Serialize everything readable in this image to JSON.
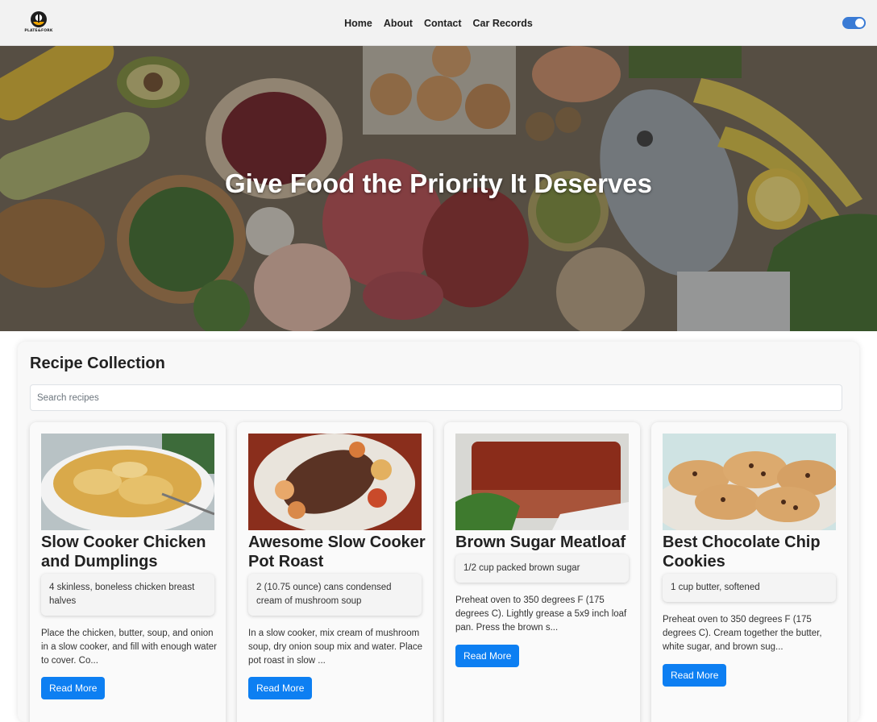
{
  "header": {
    "logo_text": "PLATE&FORK",
    "nav": [
      "Home",
      "About",
      "Contact",
      "Car Records"
    ]
  },
  "hero": {
    "title": "Give Food the Priority It Deserves"
  },
  "collection": {
    "title": "Recipe Collection",
    "search_placeholder": "Search recipes",
    "recipes": [
      {
        "title": "Slow Cooker Chicken and Dumplings",
        "ingredient": "4 skinless, boneless chicken breast halves",
        "description": "Place the chicken, butter, soup, and onion in a slow cooker, and fill with enough water to cover. Co...",
        "button": "Read More"
      },
      {
        "title": "Awesome Slow Cooker Pot Roast",
        "ingredient": "2 (10.75 ounce) cans condensed cream of mushroom soup",
        "description": "In a slow cooker, mix cream of mushroom soup, dry onion soup mix and water. Place pot roast in slow ...",
        "button": "Read More"
      },
      {
        "title": "Brown Sugar Meatloaf",
        "ingredient": "1/2 cup packed brown sugar",
        "description": "Preheat oven to 350 degrees F (175 degrees C). Lightly grease a 5x9 inch loaf pan. Press the brown s...",
        "button": "Read More"
      },
      {
        "title": "Best Chocolate Chip Cookies",
        "ingredient": "1 cup butter, softened",
        "description": "Preheat oven to 350 degrees F (175 degrees C). Cream together the butter, white sugar, and brown sug...",
        "button": "Read More"
      }
    ]
  },
  "colors": {
    "accent": "#0d7ff2",
    "toggle": "#3a7bd5",
    "navbar_bg": "#f2f2f2"
  },
  "icons": [
    "plate-fork-logo-icon",
    "theme-toggle-icon"
  ]
}
